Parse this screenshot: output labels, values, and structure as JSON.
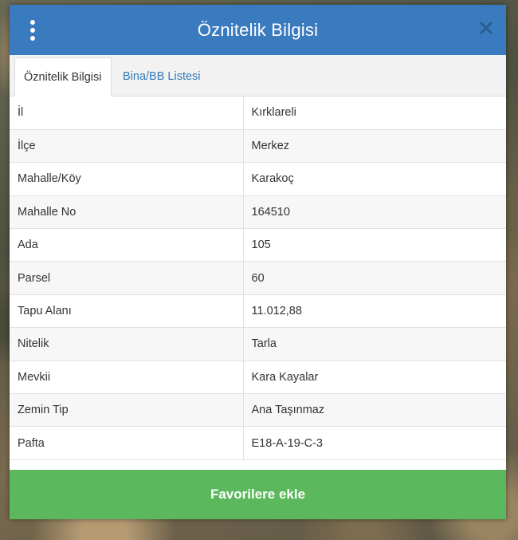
{
  "dialog": {
    "title": "Öznitelik Bilgisi",
    "header_color": "#3a7bbf",
    "menu_icon": "vertical-dots-icon",
    "close_icon": "close-icon"
  },
  "tabs": [
    {
      "label": "Öznitelik Bilgisi",
      "active": true
    },
    {
      "label": "Bina/BB Listesi",
      "active": false
    }
  ],
  "attributes": [
    {
      "key": "İl",
      "value": "Kırklareli"
    },
    {
      "key": "İlçe",
      "value": "Merkez"
    },
    {
      "key": "Mahalle/Köy",
      "value": "Karakoç"
    },
    {
      "key": "Mahalle No",
      "value": "164510"
    },
    {
      "key": "Ada",
      "value": "105"
    },
    {
      "key": "Parsel",
      "value": "60"
    },
    {
      "key": "Tapu Alanı",
      "value": "11.012,88"
    },
    {
      "key": "Nitelik",
      "value": "Tarla"
    },
    {
      "key": "Mevkii",
      "value": "Kara Kayalar"
    },
    {
      "key": "Zemin Tip",
      "value": "Ana Taşınmaz"
    },
    {
      "key": "Pafta",
      "value": "E18-A-19-C-3"
    }
  ],
  "footer": {
    "button_label": "Favorilere ekle",
    "button_color": "#5cb85c"
  }
}
